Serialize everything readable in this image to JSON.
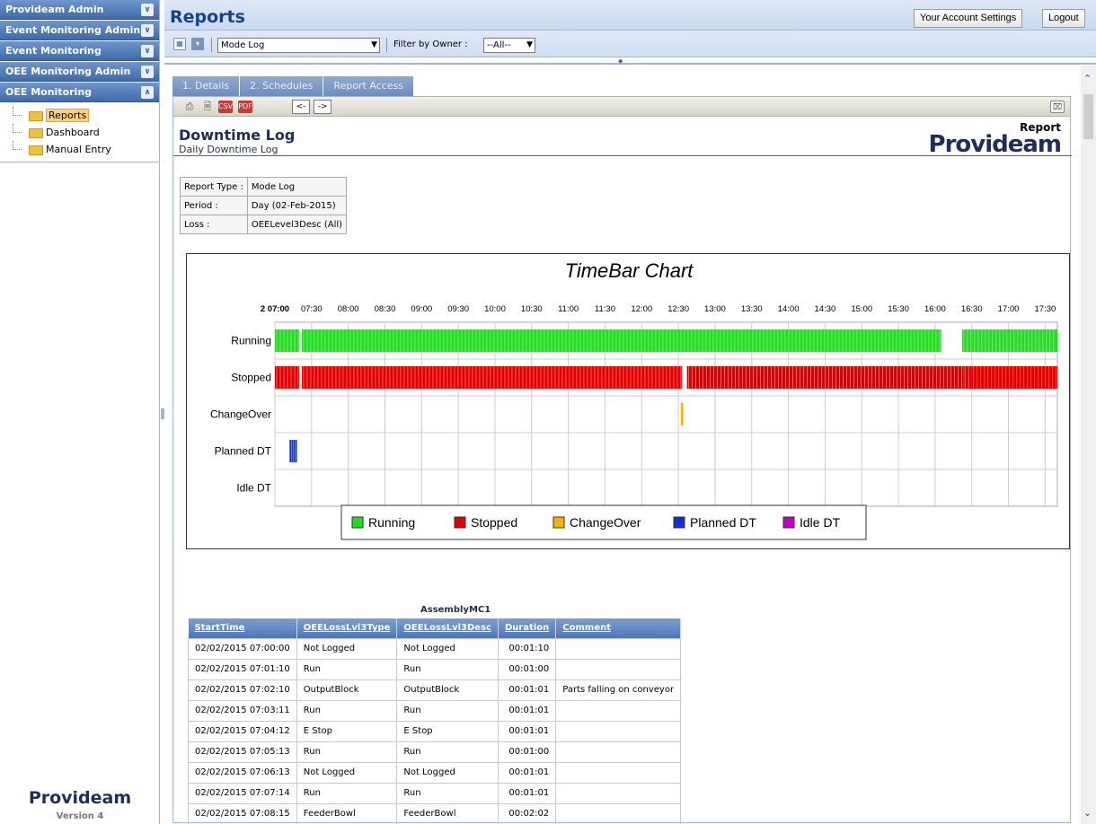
{
  "sidebar": {
    "sections": [
      "Provideam Admin",
      "Event Monitoring Admin",
      "Event Monitoring",
      "OEE Monitoring Admin",
      "OEE Monitoring"
    ],
    "tree": [
      "Reports",
      "Dashboard",
      "Manual Entry"
    ],
    "logo": "Provideam",
    "version": "Version 4"
  },
  "header": {
    "title": "Reports",
    "account_btn": "Your Account Settings",
    "logout_btn": "Logout"
  },
  "toolbar": {
    "report_select": "Mode Log",
    "filter_label": "Filter by Owner :",
    "owner_select": "--All--"
  },
  "tabs": [
    "1. Details",
    "2. Schedules",
    "Report Access"
  ],
  "report_toolbar": {
    "prev": "<-",
    "next": "->",
    "csv": "CSV",
    "pdf": "PDF"
  },
  "report": {
    "title": "Downtime Log",
    "subtitle": "Daily Downtime Log",
    "logo_text": "Report",
    "brand": "Provideam"
  },
  "info": [
    {
      "k": "Report Type :",
      "v": "Mode Log"
    },
    {
      "k": "Period :",
      "v": "Day (02-Feb-2015)"
    },
    {
      "k": "Loss :",
      "v": "OEELevel3Desc (All)"
    }
  ],
  "colors": {
    "running": "#22dd22",
    "stopped": "#e00000",
    "changeover": "#f4b400",
    "planned": "#1030d0",
    "idle": "#c000c0"
  },
  "chart_data": {
    "type": "timebar",
    "title": "TimeBar Chart",
    "x_ticks": [
      "2 07:00",
      "07:30",
      "08:00",
      "08:30",
      "09:00",
      "09:30",
      "10:00",
      "10:30",
      "11:00",
      "11:30",
      "12:00",
      "12:30",
      "13:00",
      "13:30",
      "14:00",
      "14:30",
      "15:00",
      "15:30",
      "16:00",
      "16:30",
      "17:00",
      "17:30"
    ],
    "x_range": [
      "07:00",
      "17:40"
    ],
    "categories": [
      "Running",
      "Stopped",
      "ChangeOver",
      "Planned DT",
      "Idle DT"
    ],
    "legend": [
      "Running",
      "Stopped",
      "ChangeOver",
      "Planned DT",
      "Idle DT"
    ],
    "legend_position": "bottom",
    "segments": {
      "Running": [
        [
          "07:00",
          "07:20"
        ],
        [
          "07:22",
          "16:05"
        ],
        [
          "16:22",
          "17:40"
        ]
      ],
      "Stopped": [
        [
          "07:00",
          "07:20"
        ],
        [
          "07:22",
          "12:33"
        ],
        [
          "12:37",
          "16:23"
        ],
        [
          "16:23",
          "16:30"
        ],
        [
          "16:30",
          "17:40"
        ]
      ],
      "ChangeOver": [
        [
          "12:32",
          "12:34"
        ]
      ],
      "Planned DT": [
        [
          "07:12",
          "07:18"
        ]
      ],
      "Idle DT": []
    }
  },
  "table": {
    "title": "AssemblyMC1",
    "columns": [
      "StartTime",
      "OEELossLvl3Type",
      "OEELossLvl3Desc",
      "Duration",
      "Comment"
    ],
    "rows": [
      [
        "02/02/2015 07:00:00",
        "Not Logged",
        "Not Logged",
        "00:01:10",
        ""
      ],
      [
        "02/02/2015 07:01:10",
        "Run",
        "Run",
        "00:01:00",
        ""
      ],
      [
        "02/02/2015 07:02:10",
        "OutputBlock",
        "OutputBlock",
        "00:01:01",
        "Parts falling on conveyor"
      ],
      [
        "02/02/2015 07:03:11",
        "Run",
        "Run",
        "00:01:01",
        ""
      ],
      [
        "02/02/2015 07:04:12",
        "E Stop",
        "E Stop",
        "00:01:01",
        ""
      ],
      [
        "02/02/2015 07:05:13",
        "Run",
        "Run",
        "00:01:00",
        ""
      ],
      [
        "02/02/2015 07:06:13",
        "Not Logged",
        "Not Logged",
        "00:01:01",
        ""
      ],
      [
        "02/02/2015 07:07:14",
        "Run",
        "Run",
        "00:01:01",
        ""
      ],
      [
        "02/02/2015 07:08:15",
        "FeederBowl",
        "FeederBowl",
        "00:02:02",
        ""
      ]
    ]
  }
}
